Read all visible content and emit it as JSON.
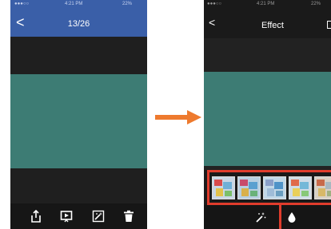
{
  "left_screen": {
    "status_bar": {
      "time": "4:21 PM",
      "battery": "22%"
    },
    "nav": {
      "title": "13/26"
    },
    "toolbar_icons": [
      "share-icon",
      "slideshow-icon",
      "magic-effect-icon",
      "trash-icon"
    ]
  },
  "arrow": {
    "color": "#ee7a2e"
  },
  "right_screen": {
    "status_bar": {
      "time": "4:21 PM",
      "battery": "22%"
    },
    "nav": {
      "title": "Effect"
    },
    "filter_thumbnails": 5,
    "toolbar_icons": [
      "magic-wand-icon",
      "water-drop-icon"
    ],
    "highlight_color": "#e03c2c"
  },
  "colors": {
    "nav_blue": "#3a5fa8",
    "photo_teal": "#3d7c74",
    "dark_bg": "#1f1f1f"
  }
}
